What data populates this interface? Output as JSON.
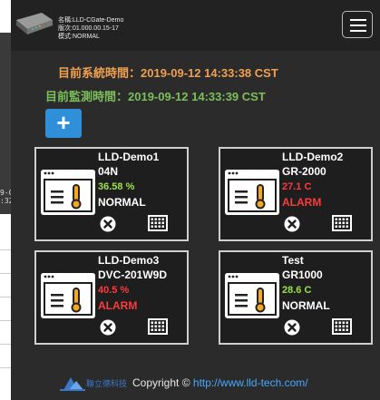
{
  "device": {
    "name_line": "名稱:LLD-CGate-Demo",
    "version_line": "版次:01.000.00.15-17",
    "mode_line": "模式:NORMAL"
  },
  "background_page": {
    "partial_text_1": "9-0",
    "partial_text_2": ":32"
  },
  "times": {
    "system": "目前系統時間：2019-09-12 14:33:38 CST",
    "monitor": "目前監測時間：2019-09-12 14:33:39 CST"
  },
  "add_button": {
    "label": "+"
  },
  "cards": [
    {
      "name": "LLD-Demo1",
      "model": "04N",
      "value": "36.58  %",
      "status": "NORMAL",
      "value_color": "#9be04a",
      "status_color": "#ffffff"
    },
    {
      "name": "LLD-Demo2",
      "model": "GR-2000",
      "value": "27.1  C",
      "status": "ALARM",
      "value_color": "#ff3a3a",
      "status_color": "#ff3a3a"
    },
    {
      "name": "LLD-Demo3",
      "model": "DVC-201W9D",
      "value": "40.5  %",
      "status": "ALARM",
      "value_color": "#ff3a3a",
      "status_color": "#ff3a3a"
    },
    {
      "name": "Test",
      "model": "GR1000",
      "value": "28.6  C",
      "status": "NORMAL",
      "value_color": "#9be04a",
      "status_color": "#ffffff"
    }
  ],
  "footer": {
    "logo_text": "聯立德科技",
    "copyright": "Copyright ©",
    "link": "http://www.lld-tech.com/"
  },
  "icons": {
    "menu": "hamburger-icon",
    "add": "plus-icon",
    "card": "thermometer-window-icon",
    "close": "close-circle-icon",
    "grid": "grid-icon"
  },
  "colors": {
    "system_time": "#f0a050",
    "monitor_time": "#7cbf5a",
    "add_button": "#2f8fd8",
    "link": "#4aa8ff"
  }
}
